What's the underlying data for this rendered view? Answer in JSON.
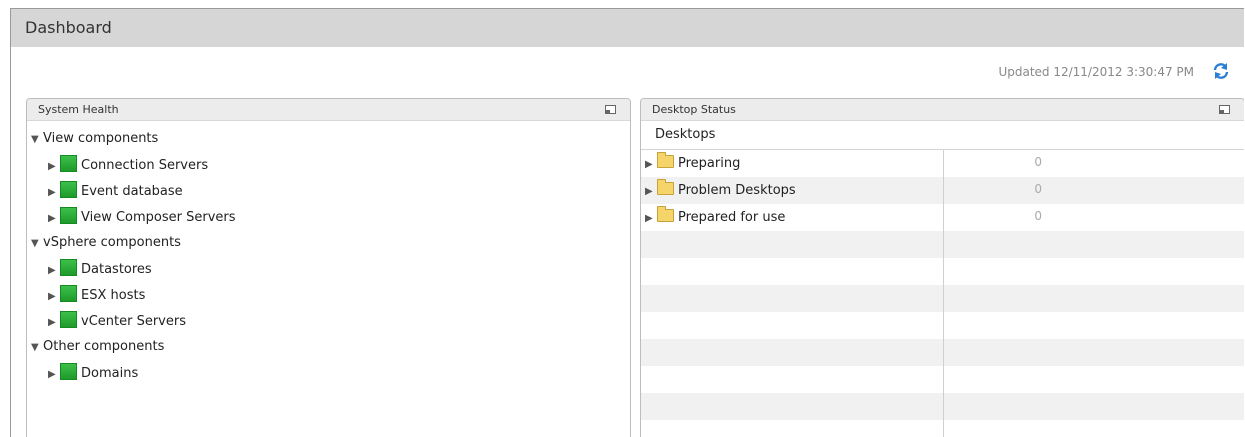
{
  "header": {
    "title": "Dashboard"
  },
  "updated": {
    "text": "Updated 12/11/2012 3:30:47 PM",
    "refresh_icon": "refresh-icon"
  },
  "system_health": {
    "title": "System Health",
    "groups": [
      {
        "label": "View components",
        "items": [
          "Connection Servers",
          "Event database",
          "View Composer Servers"
        ]
      },
      {
        "label": "vSphere components",
        "items": [
          "Datastores",
          "ESX hosts",
          "vCenter Servers"
        ]
      },
      {
        "label": "Other components",
        "items": [
          "Domains"
        ]
      }
    ]
  },
  "desktop_status": {
    "title": "Desktop Status",
    "subheader": "Desktops",
    "rows": [
      {
        "name": "Preparing",
        "value": "0"
      },
      {
        "name": "Problem Desktops",
        "value": "0"
      },
      {
        "name": "Prepared for use",
        "value": "0"
      }
    ]
  },
  "colors": {
    "status_ok": "#1e9a2a",
    "header_bg": "#d6d6d6",
    "folder": "#f5d46a"
  }
}
